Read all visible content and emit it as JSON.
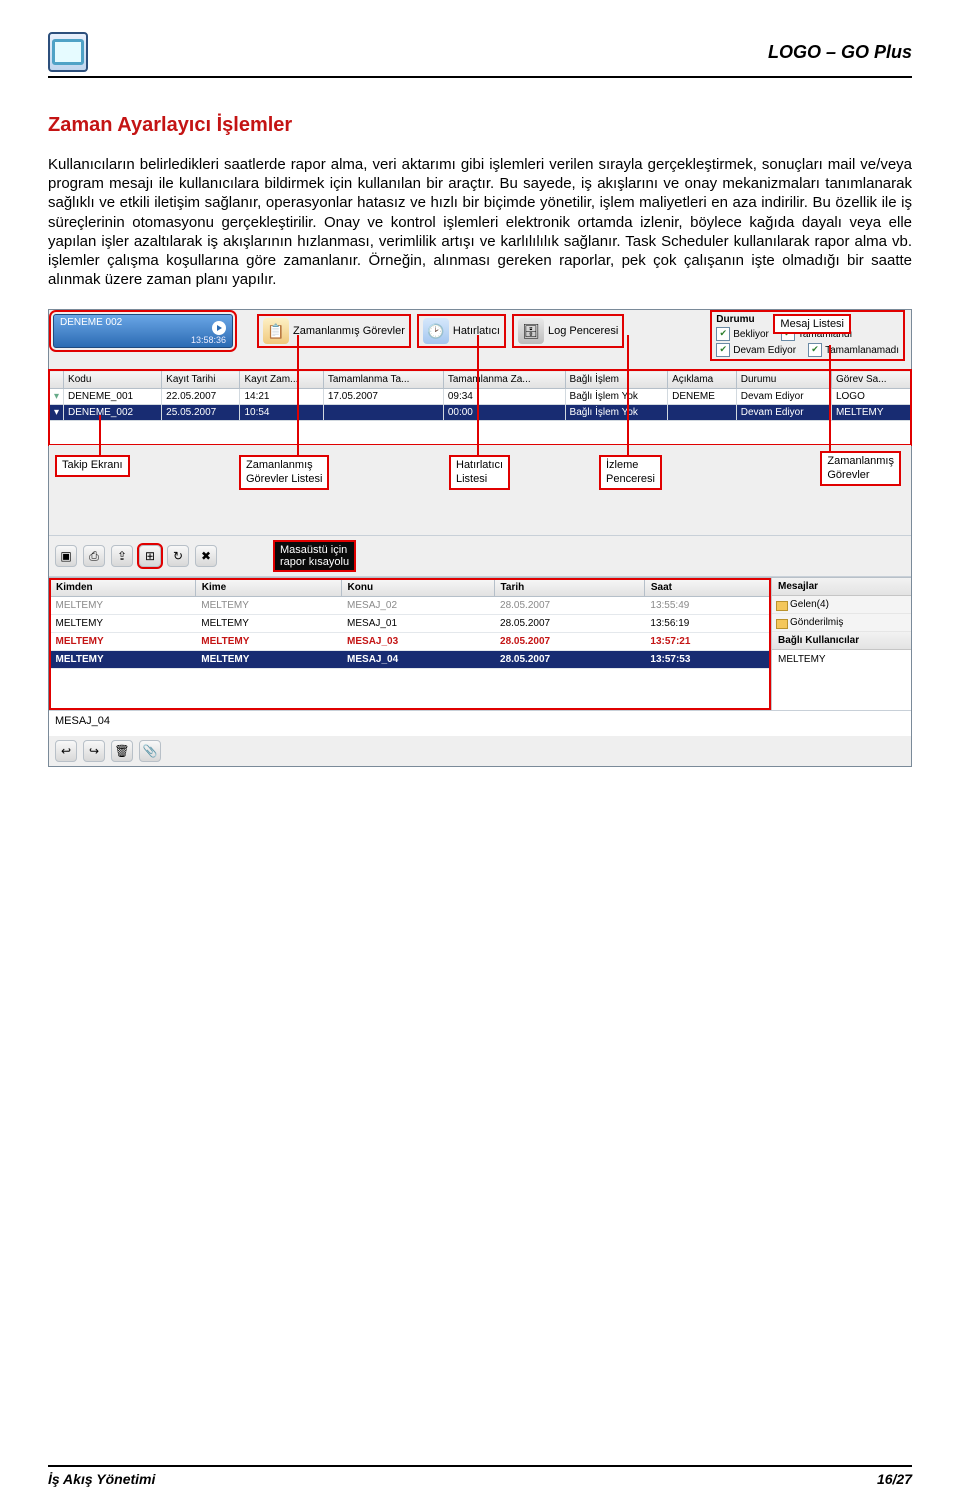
{
  "header": {
    "product": "LOGO – GO Plus"
  },
  "doc": {
    "heading": "Zaman Ayarlayıcı İşlemler",
    "paragraph": "Kullanıcıların belirledikleri saatlerde rapor alma, veri aktarımı gibi işlemleri verilen sırayla gerçekleştirmek, sonuçları mail ve/veya program mesajı ile kullanıcılara bildirmek için kullanılan bir araçtır. Bu sayede, iş akışlarını ve onay mekanizmaları tanımlanarak sağlıklı ve etkili iletişim sağlanır, operasyonlar hatasız ve hızlı bir biçimde yönetilir, işlem maliyetleri en aza indirilir. Bu özellik ile iş süreçlerinin otomasyonu gerçekleştirilir. Onay ve kontrol işlemleri elektronik ortamda izlenir, böylece kağıda dayalı veya elle yapılan işler azaltılarak iş akışlarının hızlanması, verimlilik artışı ve karlılılılık sağlanır. Task Scheduler kullanılarak rapor alma vb. işlemler çalışma koşullarına göre zamanlanır. Örneğin, alınması gereken raporlar, pek çok çalışanın işte olmadığı bir saatte alınmak üzere zaman planı yapılır."
  },
  "shot": {
    "badge": {
      "title": "DENEME  002",
      "time": "13:58:36"
    },
    "topbar": {
      "scheduled": "Zamanlanmış Görevler",
      "reminder": "Hatırlatıcı",
      "log": "Log Penceresi"
    },
    "status": {
      "label": "Durumu",
      "waiting": "Bekliyor",
      "done": "Tamamlandı",
      "running": "Devam Ediyor",
      "failed": "Tamamlanamadı"
    },
    "task_cols": {
      "kodu": "Kodu",
      "kayit_tarihi": "Kayıt Tarihi",
      "kayit_zam": "Kayıt Zam...",
      "tam_ta": "Tamamlanma Ta...",
      "tam_za": "Tamamlanma Za...",
      "bagli": "Bağlı İşlem",
      "aciklama": "Açıklama",
      "durumu": "Durumu",
      "gorev": "Görev Sa..."
    },
    "task_rows": [
      {
        "kodu": "DENEME_001",
        "kayit_tarihi": "22.05.2007",
        "kayit_zam": "14:21",
        "tam_ta": "17.05.2007",
        "tam_za": "09:34",
        "bagli": "Bağlı İşlem Yok",
        "aciklama": "DENEME",
        "durumu": "Devam Ediyor",
        "gorev": "LOGO"
      },
      {
        "kodu": "DENEME_002",
        "kayit_tarihi": "25.05.2007",
        "kayit_zam": "10:54",
        "tam_ta": "",
        "tam_za": "00:00",
        "bagli": "Bağlı İşlem Yok",
        "aciklama": "",
        "durumu": "Devam Ediyor",
        "gorev": "MELTEMY",
        "selected": true
      }
    ],
    "callouts": {
      "takip": "Takip Ekranı",
      "zam_list": "Zamanlanmış\nGörevler Listesi",
      "hat": "Hatırlatıcı\nListesi",
      "izleme": "İzleme\nPenceresi",
      "zam_gorev": "Zamanlanmış\nGörevler",
      "masaustu": "Masaüstü için\nrapor kısayolu",
      "mesaj_list": "Mesaj Listesi"
    },
    "mail_cols": {
      "kimden": "Kimden",
      "kime": "Kime",
      "konu": "Konu",
      "tarih": "Tarih",
      "saat": "Saat"
    },
    "mail_rows": [
      {
        "kimden": "MELTEMY",
        "kime": "MELTEMY",
        "konu": "MESAJ_02",
        "tarih": "28.05.2007",
        "saat": "13:55:49",
        "style": "dim"
      },
      {
        "kimden": "MELTEMY",
        "kime": "MELTEMY",
        "konu": "MESAJ_01",
        "tarih": "28.05.2007",
        "saat": "13:56:19",
        "style": ""
      },
      {
        "kimden": "MELTEMY",
        "kime": "MELTEMY",
        "konu": "MESAJ_03",
        "tarih": "28.05.2007",
        "saat": "13:57:21",
        "style": "red"
      },
      {
        "kimden": "MELTEMY",
        "kime": "MELTEMY",
        "konu": "MESAJ_04",
        "tarih": "28.05.2007",
        "saat": "13:57:53",
        "style": "sel"
      }
    ],
    "side": {
      "mesajlar": "Mesajlar",
      "gelen": "Gelen(4)",
      "gonderilmis": "Gönderilmiş",
      "bagli_kul": "Bağlı Kullanıcılar",
      "user": "MELTEMY"
    },
    "msg_field": "MESAJ_04"
  },
  "footer": {
    "left": "İş Akış Yönetimi",
    "page": "16/27"
  }
}
